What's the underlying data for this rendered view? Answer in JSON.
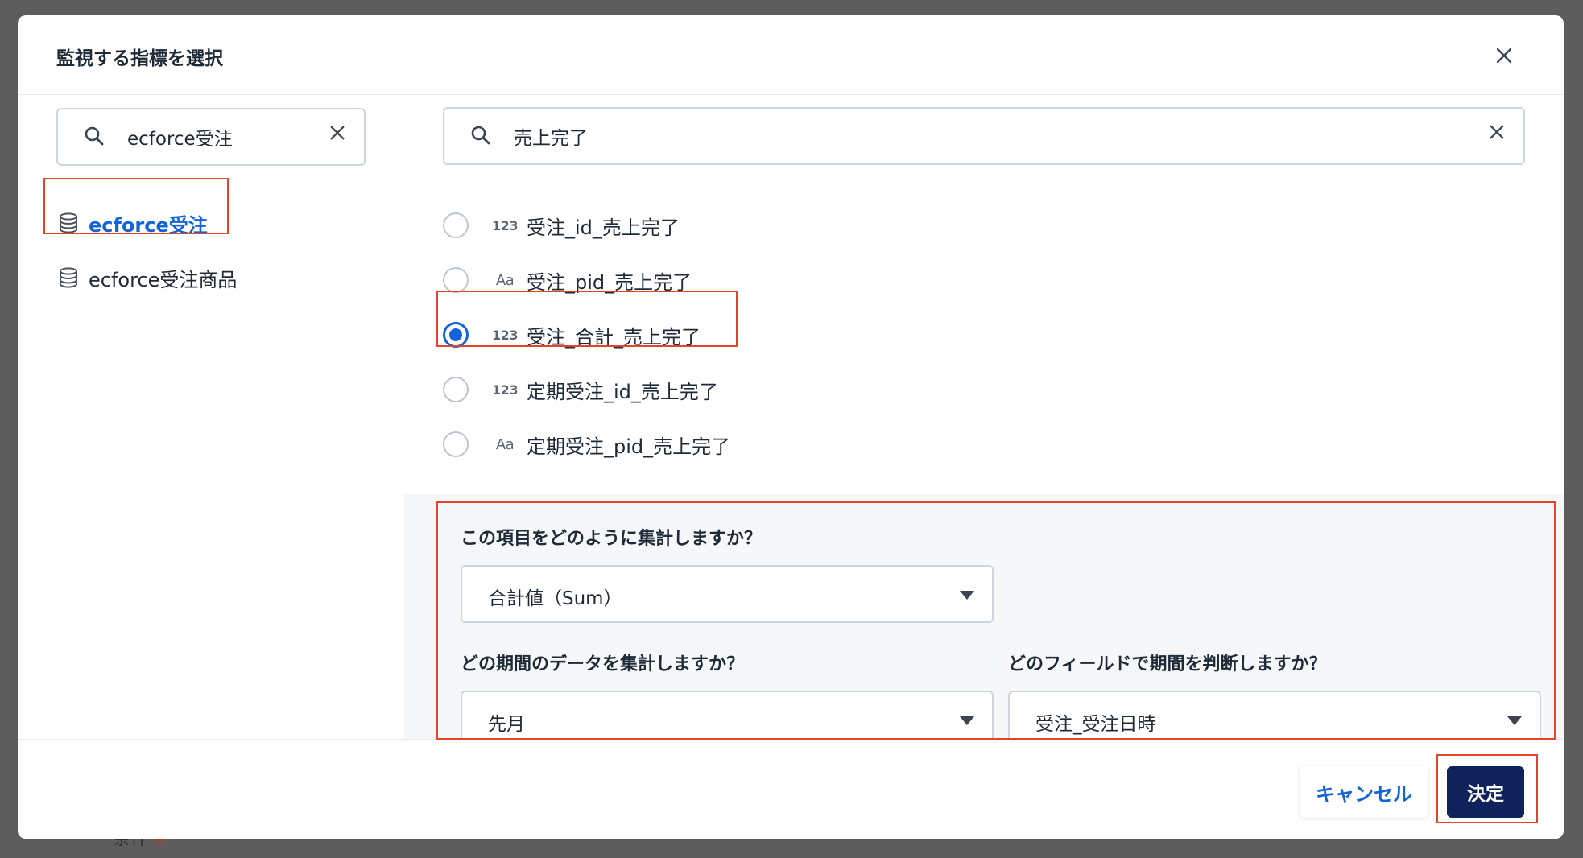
{
  "modal": {
    "title": "監視する指標を選択"
  },
  "left_search": {
    "value": "ecforce受注"
  },
  "tables": [
    {
      "label": "ecforce受注",
      "active": true
    },
    {
      "label": "ecforce受注商品",
      "active": false
    }
  ],
  "right_search": {
    "value": "売上完了"
  },
  "fields": [
    {
      "type": "123",
      "name": "受注_id_売上完了",
      "checked": false
    },
    {
      "type": "Aa",
      "name": "受注_pid_売上完了",
      "checked": false
    },
    {
      "type": "123",
      "name": "受注_合計_売上完了",
      "checked": true
    },
    {
      "type": "123",
      "name": "定期受注_id_売上完了",
      "checked": false
    },
    {
      "type": "Aa",
      "name": "定期受注_pid_売上完了",
      "checked": false
    }
  ],
  "aggregation": {
    "question": "この項目をどのように集計しますか？",
    "value": "合計値（Sum）"
  },
  "period": {
    "question": "どの期間のデータを集計しますか？",
    "value": "先月"
  },
  "period_field": {
    "question": "どのフィールドで期間を判断しますか？",
    "value": "受注_受注日時"
  },
  "footer": {
    "cancel_label": "キャンセル",
    "confirm_label": "決定"
  },
  "background": {
    "partial_label": "条件",
    "required_mark": "※"
  },
  "colors": {
    "accent": "#1464d9",
    "primary_button": "#10225a",
    "annotation_red": "#e5442a"
  }
}
